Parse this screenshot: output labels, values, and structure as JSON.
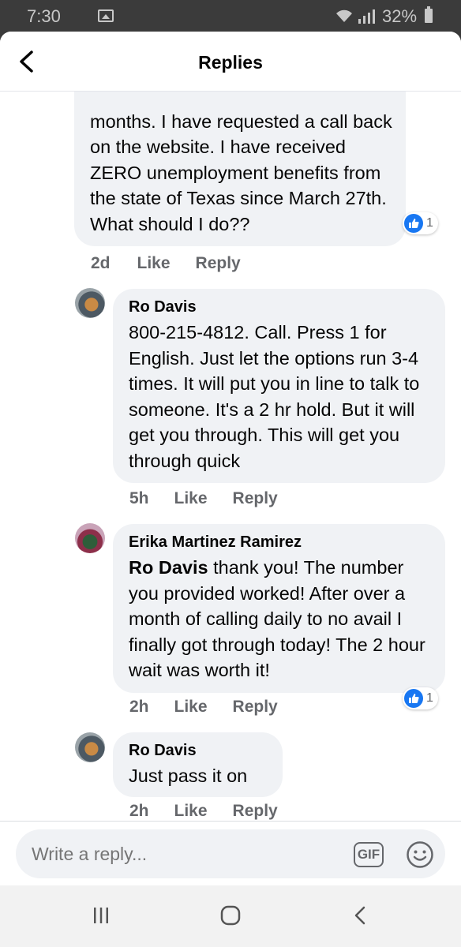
{
  "status_bar": {
    "time": "7:30",
    "battery": "32%"
  },
  "header": {
    "title": "Replies"
  },
  "comments": [
    {
      "text": "months. I have requested a call back on the website. I have received ZERO unemployment benefits from the state of Texas since March 27th. What should I do??",
      "reaction_count": "1",
      "time": "2d",
      "like_label": "Like",
      "reply_label": "Reply"
    },
    {
      "author": "Ro Davis",
      "text": "800-215-4812. Call. Press 1 for English.  Just let the options run 3-4 times. It will put you in line to talk to someone. It's a 2 hr hold. But it will get you through. This will get you through quick",
      "time": "5h",
      "like_label": "Like",
      "reply_label": "Reply"
    },
    {
      "author": "Erika Martinez Ramirez",
      "mention": "Ro Davis",
      "text": " thank you! The number you provided worked! After over a month of calling daily to no avail I finally got through today! The 2 hour wait was worth it!",
      "reaction_count": "1",
      "time": "2h",
      "like_label": "Like",
      "reply_label": "Reply"
    },
    {
      "author": "Ro Davis",
      "text": "Just pass it on",
      "time": "2h",
      "like_label": "Like",
      "reply_label": "Reply"
    }
  ],
  "composer": {
    "placeholder": "Write a reply...",
    "gif_label": "GIF"
  },
  "icons": {
    "back": "chevron-left-icon",
    "like": "thumbs-up-icon",
    "emoji": "smiley-icon",
    "gif": "gif-icon",
    "nav_recent": "recent-apps-icon",
    "nav_home": "home-icon",
    "nav_back": "nav-back-icon"
  },
  "colors": {
    "like_blue": "#1877f2",
    "bubble": "#f0f2f5",
    "meta": "#65676b"
  }
}
